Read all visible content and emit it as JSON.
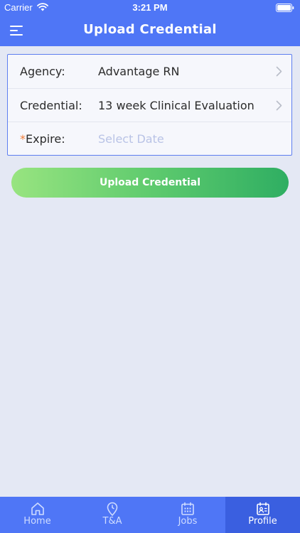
{
  "status_bar": {
    "carrier": "Carrier",
    "time": "3:21 PM"
  },
  "header": {
    "title": "Upload Credential",
    "menu_icon": "menu-icon"
  },
  "form": {
    "agency": {
      "label": "Agency:",
      "value": "Advantage RN"
    },
    "credential": {
      "label": "Credential:",
      "value": "13 week Clinical Evaluation"
    },
    "expire": {
      "required_mark": "*",
      "label": "Expire:",
      "placeholder": "Select Date"
    }
  },
  "upload_button": {
    "label": "Upload Credential"
  },
  "tabs": [
    {
      "label": "Home",
      "icon": "home-icon"
    },
    {
      "label": "T&A",
      "icon": "location-pin-icon"
    },
    {
      "label": "Jobs",
      "icon": "calendar-icon"
    },
    {
      "label": "Profile",
      "icon": "profile-card-icon",
      "active": true
    }
  ],
  "colors": {
    "primary": "#4f76f6",
    "active_tab": "#3a5fe0",
    "background": "#e4e8f4",
    "button_gradient_start": "#98e480",
    "button_gradient_end": "#2fae62",
    "required": "#f07d3a"
  }
}
